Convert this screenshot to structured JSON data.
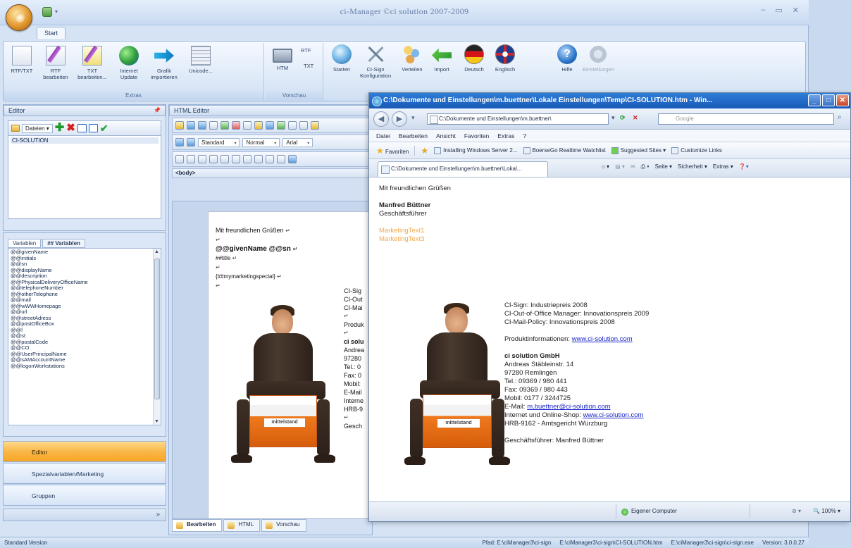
{
  "app": {
    "title": "ci-Manager ©ci solution 2007-2009",
    "ribbon_tab": "Start"
  },
  "ribbon": {
    "groups": {
      "extras": "Extras",
      "vorschau": "Vorschau"
    },
    "buttons": {
      "rtf_txt": "RTF/TXT",
      "rtf_bearbeiten": "RTF bearbeiten",
      "txt_bearbeiten": "TXT bearbeiten...",
      "internet_update": "Internet Update",
      "grafik_importieren": "Grafik importieren",
      "unicode": "Unicode...",
      "htm": "HTM",
      "rtf_small": "RTF",
      "txt_small": "TXT",
      "starten": "Starten",
      "ci_sign_konfiguration": "CI-Sign Konfiguration",
      "verteilen": "Verteilen",
      "import": "Import",
      "deutsch": "Deutsch",
      "englisch": "Englisch",
      "hilfe": "Hilfe",
      "einstellungen": "Einstellungen"
    }
  },
  "left_panel": {
    "editor_header": "Editor",
    "files_dropdown": "Dateien",
    "file_items": [
      "CI-SOLUTION"
    ],
    "vars_tabs": [
      "Variablen",
      "## Variablen"
    ],
    "variables": [
      "@@givenName",
      "@@initials",
      "@@sn",
      "@@displayName",
      "@@description",
      "@@PhysicalDeliveryOfficeName",
      "@@telephoneNumber",
      "@@otherTelephone",
      "@@mail",
      "@@wWWHomepage",
      "@@url",
      "@@streetAdress",
      "@@postOfficeBox",
      "@@l",
      "@@st",
      "@@postalCode",
      "@@CO",
      "@@UserPrincipalName",
      "@@sAMAccountName",
      "@@logonWorkstations"
    ],
    "nav": [
      "Editor",
      "Spezialvariablen/Marketing",
      "Gruppen"
    ]
  },
  "html_editor": {
    "header": "HTML Editor",
    "style_select": "Standard",
    "format_select": "Normal",
    "font_select": "Arial",
    "tag_path": "<body>",
    "lines": {
      "greeting": "Mit freundlichen Grüßen",
      "name_vars": "@@givenName @@sn",
      "title_var": "##title",
      "marketing_var": "{##mymarketingspecial}"
    },
    "sig_partial": [
      "CI-Sig",
      "CI-Out",
      "CI-Mai",
      "",
      "Produk",
      "",
      "ci solu",
      "Andrea",
      "97280",
      "Tel.: 0",
      "Fax: 0",
      "Mobil:",
      "E-Mail",
      "Interne",
      "HRB-9",
      "",
      "Gesch"
    ],
    "box_label": "mittelstand",
    "tabs": [
      "Bearbeiten",
      "HTML",
      "Vorschau"
    ]
  },
  "ie": {
    "title": "C:\\Dokumente und Einstellungen\\m.buettner\\Lokale Einstellungen\\Temp\\CI-SOLUTION.htm - Win...",
    "url": "C:\\Dokumente und Einstellungen\\m.buettner\\",
    "search_placeholder": "Google",
    "menu": [
      "Datei",
      "Bearbeiten",
      "Ansicht",
      "Favoriten",
      "Extras",
      "?"
    ],
    "favorites": {
      "label": "Favoriten",
      "items": [
        "Installing Windows Server 2...",
        "BoerseGo Realtime Watchlist",
        "Suggested Sites ▾",
        "Customize Links"
      ]
    },
    "tab_title": "C:\\Dokumente und Einstellungen\\m.buettner\\Lokal...",
    "commands": [
      "Seite ▾",
      "Sicherheit ▾",
      "Extras ▾"
    ],
    "content": {
      "greeting": "Mit freundlichen Grüßen",
      "name": "Manfred Büttner",
      "role": "Geschäftsführer",
      "marketing1": "MarketingText1",
      "marketing2": "MarketingText3",
      "awards": [
        "CI-Sign: Industriepreis 2008",
        "CI-Out-of-Office Manager: Innovationspreis 2009",
        "CI-Mail-Policy: Innovationspreis 2008"
      ],
      "product_label": "Produktinformationen:",
      "product_link": "www.ci-solution.com",
      "company": "ci solution GmbH",
      "street": "Andreas Stäbleinstr. 14",
      "city": "97280 Remlingen",
      "tel": "Tel.: 09369 / 980 441",
      "fax": "Fax: 09369 / 980 443",
      "mobile": "Mobil: 0177 / 3244725",
      "email_label": "E-Mail:",
      "email": "m.buettner@ci-solution.com",
      "shop_label": "Internet und Online-Shop:",
      "shop_link": "www.ci-solution.com",
      "hrb": "HRB-9162 - Amtsgericht Würzburg",
      "ceo": "Geschäftsführer: Manfred Büttner",
      "box_label": "mittelstand"
    },
    "status": {
      "zone": "Eigener Computer",
      "zoom": "100%"
    }
  },
  "statusbar": {
    "left": "Standard Version",
    "pfad": "Pfad: E:\\ciManager3\\ci-sign",
    "file": "E:\\ciManager3\\ci-sign\\CI-SOLUTION.htm",
    "exe": "E:\\ciManager3\\ci-sign\\ci-sign.exe",
    "version": "Version: 3.0.0.27"
  }
}
